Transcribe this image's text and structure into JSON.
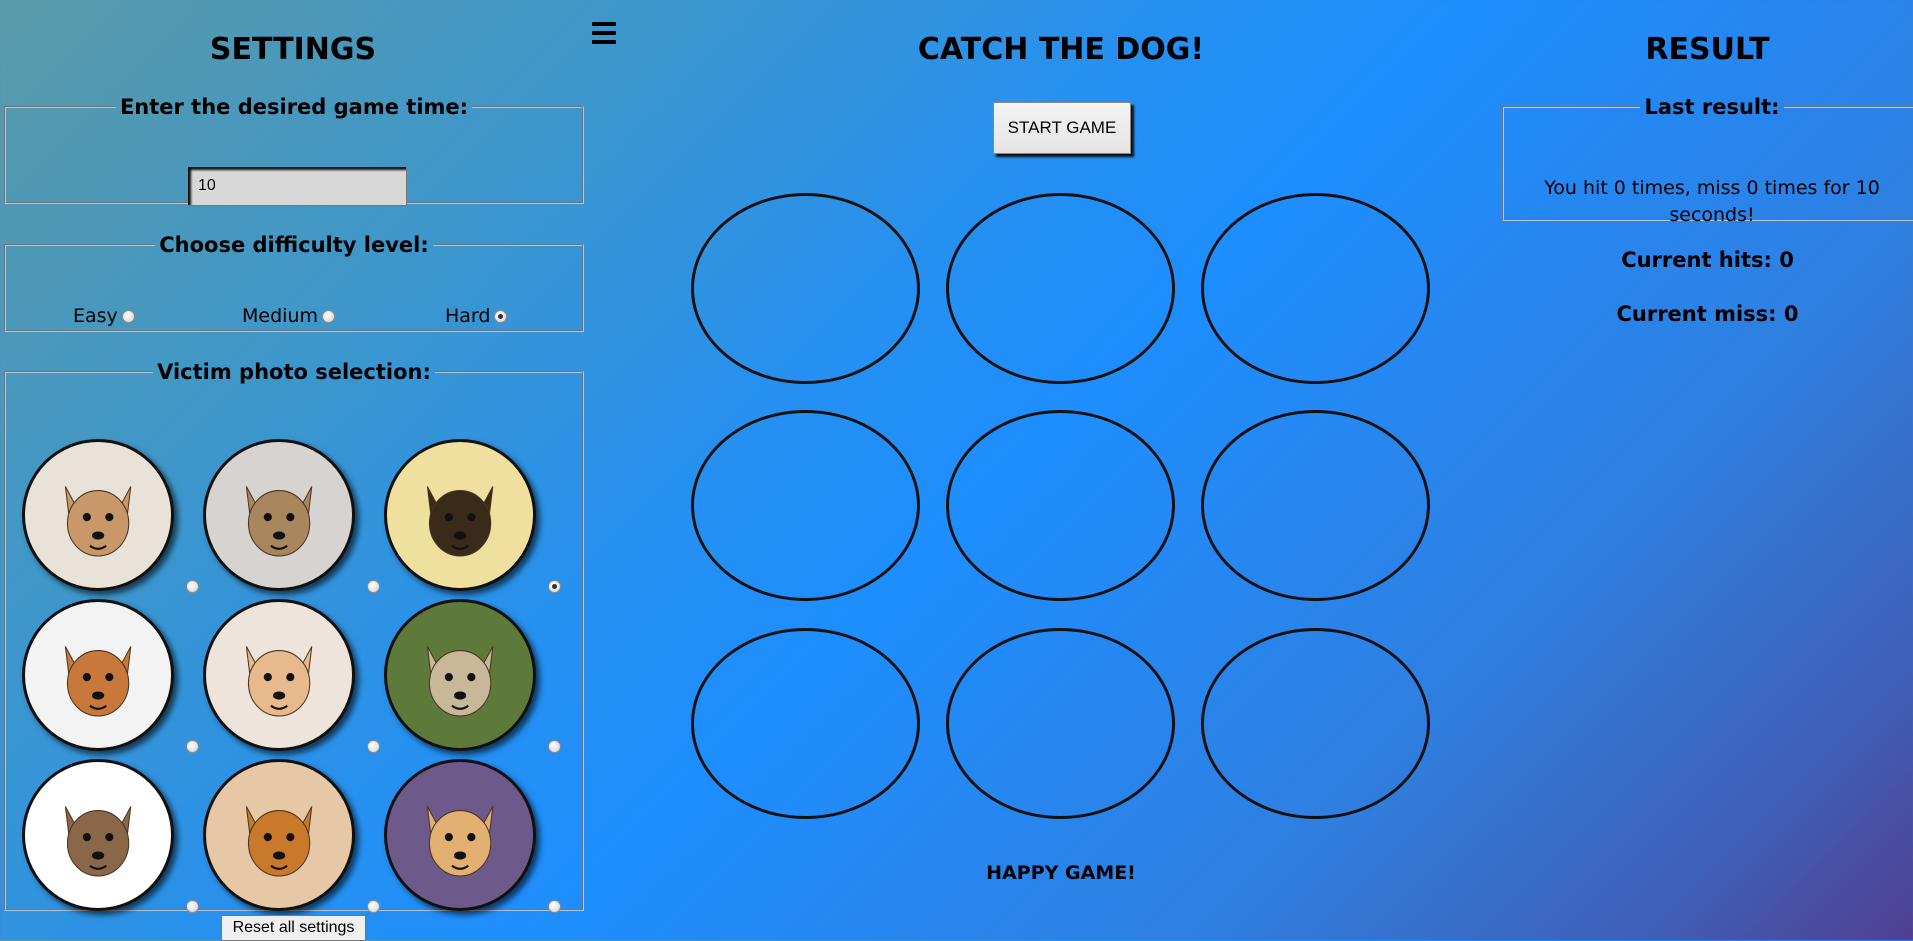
{
  "settings": {
    "title": "SETTINGS",
    "time_legend": "Enter the desired game time:",
    "time_value": "10",
    "difficulty_legend": "Choose difficulty level:",
    "difficulty": [
      {
        "label": "Easy",
        "checked": false
      },
      {
        "label": "Medium",
        "checked": false
      },
      {
        "label": "Hard",
        "checked": true
      }
    ],
    "photo_legend": "Victim photo selection:",
    "photos": [
      {
        "name": "chihuahua-snarling",
        "bg": "#e9e2d8",
        "fur": "#c89868",
        "checked": false
      },
      {
        "name": "dog-barking",
        "bg": "#d6d3d0",
        "fur": "#a8865e",
        "checked": false
      },
      {
        "name": "shepherd-growling",
        "bg": "#f0e0a0",
        "fur": "#3a2a1a",
        "checked": true
      },
      {
        "name": "chihuahua-angry",
        "bg": "#f3f3f3",
        "fur": "#c8783a",
        "checked": false
      },
      {
        "name": "pomeranian-flower",
        "bg": "#efe4dc",
        "fur": "#e7b98d",
        "checked": false
      },
      {
        "name": "pug",
        "bg": "#5e7a3a",
        "fur": "#c9b79a",
        "checked": false
      },
      {
        "name": "chihuahua-standing",
        "bg": "#ffffff",
        "fur": "#8a6748",
        "checked": false
      },
      {
        "name": "pomeranian-orange",
        "bg": "#e6c8a6",
        "fur": "#c9792a",
        "checked": false
      },
      {
        "name": "pomeranian-smiling",
        "bg": "#6d5a8a",
        "fur": "#e2b070",
        "checked": false
      }
    ],
    "reset_label": "Reset all settings"
  },
  "game": {
    "title": "CATCH THE DOG!",
    "start_label": "START GAME",
    "footer": "HAPPY GAME!"
  },
  "result": {
    "title": "RESULT",
    "last_legend": "Last result:",
    "last_text": "You hit 0 times, miss 0 times for 10 seconds!",
    "hits": "Current hits: 0",
    "miss": "Current miss: 0"
  }
}
